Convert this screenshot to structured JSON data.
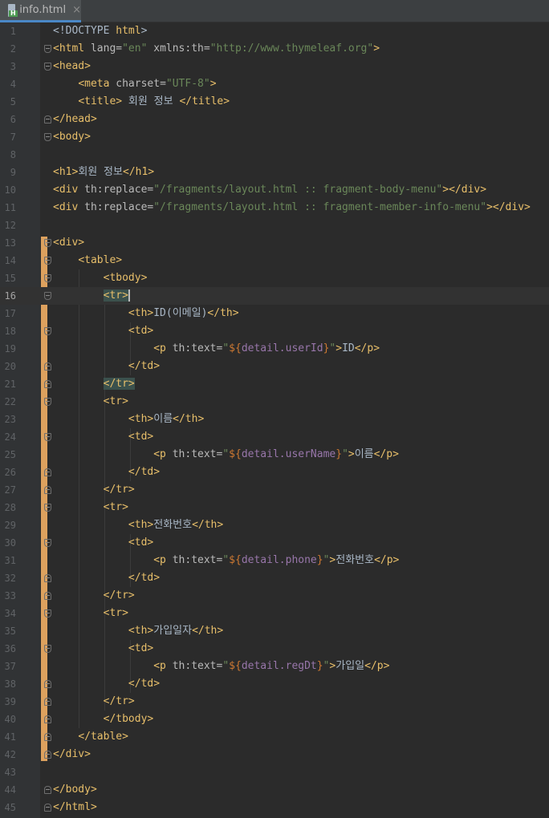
{
  "tab": {
    "filename": "info.html",
    "close_glyph": "×"
  },
  "accent_color": "#4a88c7",
  "current_line": 16,
  "lines": [
    {
      "n": "1",
      "segs": [
        [
          "p",
          "<!DOCTYPE "
        ],
        [
          "t",
          "html"
        ],
        [
          "p",
          ">"
        ]
      ]
    },
    {
      "n": "2",
      "segs": [
        [
          "t",
          "<html "
        ],
        [
          "a",
          "lang="
        ],
        [
          "s",
          "\"en\" "
        ],
        [
          "a",
          "xmlns:th="
        ],
        [
          "s",
          "\"http://www.thymeleaf.org\""
        ],
        [
          "t",
          ">"
        ]
      ]
    },
    {
      "n": "3",
      "segs": [
        [
          "t",
          "<head>"
        ]
      ]
    },
    {
      "n": "4",
      "segs": [
        [
          "p",
          "    "
        ],
        [
          "t",
          "<meta "
        ],
        [
          "a",
          "charset="
        ],
        [
          "s",
          "\"UTF-8\""
        ],
        [
          "t",
          ">"
        ]
      ]
    },
    {
      "n": "5",
      "segs": [
        [
          "p",
          "    "
        ],
        [
          "t",
          "<title>"
        ],
        [
          "p",
          " 회원 정보 "
        ],
        [
          "t",
          "</title>"
        ]
      ]
    },
    {
      "n": "6",
      "segs": [
        [
          "t",
          "</head>"
        ]
      ]
    },
    {
      "n": "7",
      "segs": [
        [
          "t",
          "<body>"
        ]
      ]
    },
    {
      "n": "8",
      "segs": []
    },
    {
      "n": "9",
      "segs": [
        [
          "t",
          "<h1>"
        ],
        [
          "p",
          "회원 정보"
        ],
        [
          "t",
          "</h1>"
        ]
      ]
    },
    {
      "n": "10",
      "segs": [
        [
          "t",
          "<div "
        ],
        [
          "a",
          "th:replace="
        ],
        [
          "s",
          "\"/fragments/layout.html :: fragment-body-menu\""
        ],
        [
          "t",
          "></div>"
        ]
      ]
    },
    {
      "n": "11",
      "segs": [
        [
          "t",
          "<div "
        ],
        [
          "a",
          "th:replace="
        ],
        [
          "s",
          "\"/fragments/layout.html :: fragment-member-info-menu\""
        ],
        [
          "t",
          "></div>"
        ]
      ]
    },
    {
      "n": "12",
      "segs": []
    },
    {
      "n": "13",
      "segs": [
        [
          "t",
          "<div>"
        ]
      ]
    },
    {
      "n": "14",
      "segs": [
        [
          "p",
          "    "
        ],
        [
          "t",
          "<table>"
        ]
      ]
    },
    {
      "n": "15",
      "segs": [
        [
          "p",
          "        "
        ],
        [
          "t",
          "<tbody>"
        ]
      ]
    },
    {
      "n": "16",
      "segs": [
        [
          "p",
          "        "
        ],
        [
          "th",
          "<tr>"
        ]
      ]
    },
    {
      "n": "17",
      "segs": [
        [
          "p",
          "            "
        ],
        [
          "t",
          "<th>"
        ],
        [
          "p",
          "ID(이메일)"
        ],
        [
          "t",
          "</th>"
        ]
      ]
    },
    {
      "n": "18",
      "segs": [
        [
          "p",
          "            "
        ],
        [
          "t",
          "<td>"
        ]
      ]
    },
    {
      "n": "19",
      "segs": [
        [
          "p",
          "                "
        ],
        [
          "t",
          "<p "
        ],
        [
          "a",
          "th:text="
        ],
        [
          "s",
          "\""
        ],
        [
          "e",
          "${"
        ],
        [
          "x",
          "detail.userId"
        ],
        [
          "e",
          "}"
        ],
        [
          "s",
          "\""
        ],
        [
          "t",
          ">"
        ],
        [
          "p",
          "ID"
        ],
        [
          "t",
          "</p>"
        ]
      ]
    },
    {
      "n": "20",
      "segs": [
        [
          "p",
          "            "
        ],
        [
          "t",
          "</td>"
        ]
      ]
    },
    {
      "n": "21",
      "segs": [
        [
          "p",
          "        "
        ],
        [
          "th",
          "</tr>"
        ]
      ]
    },
    {
      "n": "22",
      "segs": [
        [
          "p",
          "        "
        ],
        [
          "t",
          "<tr>"
        ]
      ]
    },
    {
      "n": "23",
      "segs": [
        [
          "p",
          "            "
        ],
        [
          "t",
          "<th>"
        ],
        [
          "p",
          "이름"
        ],
        [
          "t",
          "</th>"
        ]
      ]
    },
    {
      "n": "24",
      "segs": [
        [
          "p",
          "            "
        ],
        [
          "t",
          "<td>"
        ]
      ]
    },
    {
      "n": "25",
      "segs": [
        [
          "p",
          "                "
        ],
        [
          "t",
          "<p "
        ],
        [
          "a",
          "th:text="
        ],
        [
          "s",
          "\""
        ],
        [
          "e",
          "${"
        ],
        [
          "x",
          "detail.userName"
        ],
        [
          "e",
          "}"
        ],
        [
          "s",
          "\""
        ],
        [
          "t",
          ">"
        ],
        [
          "p",
          "이름"
        ],
        [
          "t",
          "</p>"
        ]
      ]
    },
    {
      "n": "26",
      "segs": [
        [
          "p",
          "            "
        ],
        [
          "t",
          "</td>"
        ]
      ]
    },
    {
      "n": "27",
      "segs": [
        [
          "p",
          "        "
        ],
        [
          "t",
          "</tr>"
        ]
      ]
    },
    {
      "n": "28",
      "segs": [
        [
          "p",
          "        "
        ],
        [
          "t",
          "<tr>"
        ]
      ]
    },
    {
      "n": "29",
      "segs": [
        [
          "p",
          "            "
        ],
        [
          "t",
          "<th>"
        ],
        [
          "p",
          "전화번호"
        ],
        [
          "t",
          "</th>"
        ]
      ]
    },
    {
      "n": "30",
      "segs": [
        [
          "p",
          "            "
        ],
        [
          "t",
          "<td>"
        ]
      ]
    },
    {
      "n": "31",
      "segs": [
        [
          "p",
          "                "
        ],
        [
          "t",
          "<p "
        ],
        [
          "a",
          "th:text="
        ],
        [
          "s",
          "\""
        ],
        [
          "e",
          "${"
        ],
        [
          "x",
          "detail.phone"
        ],
        [
          "e",
          "}"
        ],
        [
          "s",
          "\""
        ],
        [
          "t",
          ">"
        ],
        [
          "p",
          "전화번호"
        ],
        [
          "t",
          "</p>"
        ]
      ]
    },
    {
      "n": "32",
      "segs": [
        [
          "p",
          "            "
        ],
        [
          "t",
          "</td>"
        ]
      ]
    },
    {
      "n": "33",
      "segs": [
        [
          "p",
          "        "
        ],
        [
          "t",
          "</tr>"
        ]
      ]
    },
    {
      "n": "34",
      "segs": [
        [
          "p",
          "        "
        ],
        [
          "t",
          "<tr>"
        ]
      ]
    },
    {
      "n": "35",
      "segs": [
        [
          "p",
          "            "
        ],
        [
          "t",
          "<th>"
        ],
        [
          "p",
          "가입일자"
        ],
        [
          "t",
          "</th>"
        ]
      ]
    },
    {
      "n": "36",
      "segs": [
        [
          "p",
          "            "
        ],
        [
          "t",
          "<td>"
        ]
      ]
    },
    {
      "n": "37",
      "segs": [
        [
          "p",
          "                "
        ],
        [
          "t",
          "<p "
        ],
        [
          "a",
          "th:text="
        ],
        [
          "s",
          "\""
        ],
        [
          "e",
          "${"
        ],
        [
          "x",
          "detail.regDt"
        ],
        [
          "e",
          "}"
        ],
        [
          "s",
          "\""
        ],
        [
          "t",
          ">"
        ],
        [
          "p",
          "가입일"
        ],
        [
          "t",
          "</p>"
        ]
      ]
    },
    {
      "n": "38",
      "segs": [
        [
          "p",
          "            "
        ],
        [
          "t",
          "</td>"
        ]
      ]
    },
    {
      "n": "39",
      "segs": [
        [
          "p",
          "        "
        ],
        [
          "t",
          "</tr>"
        ]
      ]
    },
    {
      "n": "40",
      "segs": [
        [
          "p",
          "        "
        ],
        [
          "t",
          "</tbody>"
        ]
      ]
    },
    {
      "n": "41",
      "segs": [
        [
          "p",
          "    "
        ],
        [
          "t",
          "</table>"
        ]
      ]
    },
    {
      "n": "42",
      "segs": [
        [
          "t",
          "</div>"
        ]
      ]
    },
    {
      "n": "43",
      "segs": []
    },
    {
      "n": "44",
      "segs": [
        [
          "t",
          "</body>"
        ]
      ]
    },
    {
      "n": "45",
      "segs": [
        [
          "t",
          "</html>"
        ]
      ]
    }
  ]
}
